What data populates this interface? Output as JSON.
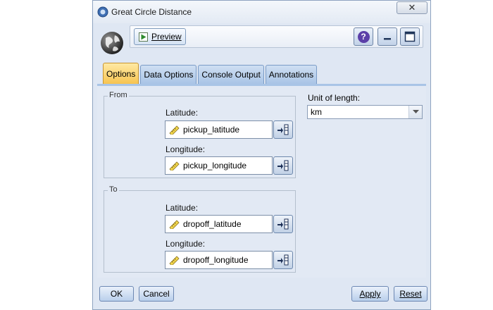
{
  "window": {
    "title": "Great Circle Distance",
    "close_symbol": "✕"
  },
  "toolbar": {
    "preview_label": "Preview"
  },
  "tabs": [
    {
      "label": "Options",
      "active": true
    },
    {
      "label": "Data Options",
      "active": false
    },
    {
      "label": "Console Output",
      "active": false
    },
    {
      "label": "Annotations",
      "active": false
    }
  ],
  "from": {
    "legend": "From",
    "latitude_label": "Latitude:",
    "latitude_value": "pickup_latitude",
    "longitude_label": "Longitude:",
    "longitude_value": "pickup_longitude"
  },
  "to": {
    "legend": "To",
    "latitude_label": "Latitude:",
    "latitude_value": "dropoff_latitude",
    "longitude_label": "Longitude:",
    "longitude_value": "dropoff_longitude"
  },
  "unit": {
    "label": "Unit of length:",
    "value": "km"
  },
  "footer": {
    "ok": "OK",
    "cancel": "Cancel",
    "apply": "Apply",
    "reset": "Reset"
  },
  "colors": {
    "active_tab": "#f7c451",
    "tab": "#a9c4e6",
    "help": "#5b3fa8"
  },
  "icons": {
    "title": "node-icon",
    "globe": "globe-icon",
    "play": "play-icon",
    "help": "help-icon",
    "minimize": "minimize-icon",
    "maximize": "maximize-icon",
    "ruler": "ruler-icon",
    "picker": "field-picker-icon",
    "dropdown": "chevron-down-icon"
  }
}
